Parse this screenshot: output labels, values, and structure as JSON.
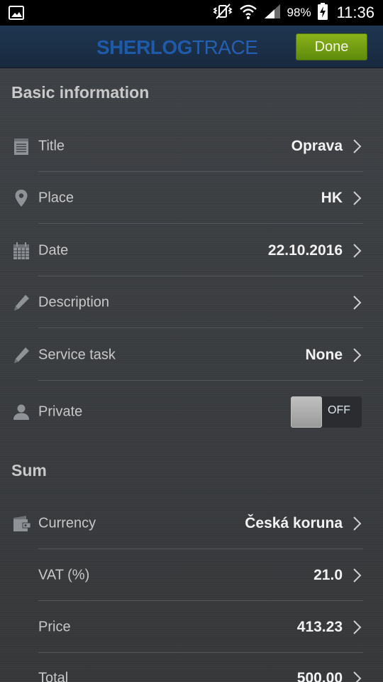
{
  "status_bar": {
    "battery_percent": "98%",
    "time": "11:36"
  },
  "header": {
    "logo_main": "SHERLOG",
    "logo_sub": "TRACE",
    "done_label": "Done"
  },
  "sections": {
    "basic_title": "Basic information",
    "sum_title": "Sum"
  },
  "basic": {
    "title": {
      "label": "Title",
      "value": "Oprava",
      "icon": "notepad-icon"
    },
    "place": {
      "label": "Place",
      "value": "HK",
      "icon": "map-pin-icon"
    },
    "date": {
      "label": "Date",
      "value": "22.10.2016",
      "icon": "calendar-icon"
    },
    "description": {
      "label": "Description",
      "value": "",
      "icon": "pencil-icon"
    },
    "service_task": {
      "label": "Service task",
      "value": "None",
      "icon": "pencil-icon"
    },
    "private": {
      "label": "Private",
      "toggle_state": "OFF",
      "icon": "person-icon"
    }
  },
  "sum": {
    "currency": {
      "label": "Currency",
      "value": "Česká koruna",
      "icon": "wallet-icon"
    },
    "vat": {
      "label": "VAT (%)",
      "value": "21.0"
    },
    "price": {
      "label": "Price",
      "value": "413.23"
    },
    "total": {
      "label": "Total",
      "value": "500.00"
    }
  }
}
